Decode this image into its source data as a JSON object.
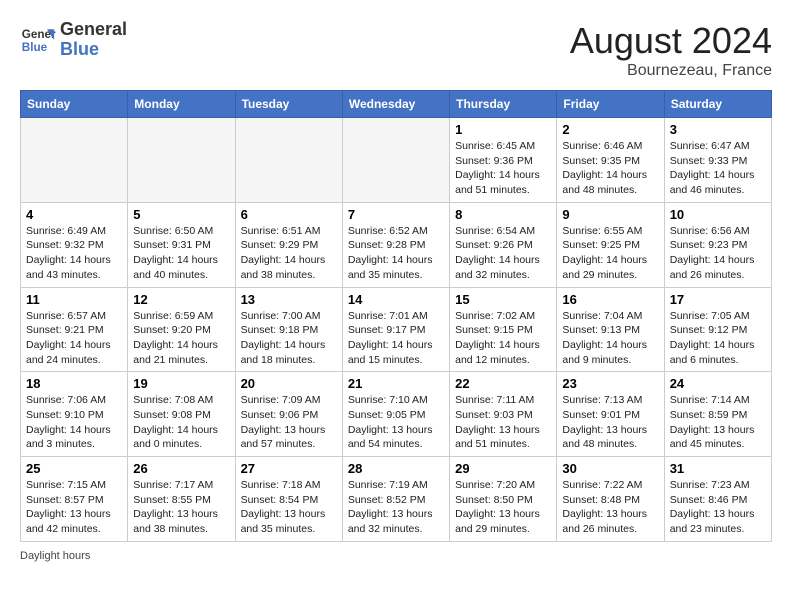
{
  "header": {
    "logo_line1": "General",
    "logo_line2": "Blue",
    "month_year": "August 2024",
    "location": "Bournezeau, France"
  },
  "days_of_week": [
    "Sunday",
    "Monday",
    "Tuesday",
    "Wednesday",
    "Thursday",
    "Friday",
    "Saturday"
  ],
  "weeks": [
    [
      {
        "day": "",
        "info": ""
      },
      {
        "day": "",
        "info": ""
      },
      {
        "day": "",
        "info": ""
      },
      {
        "day": "",
        "info": ""
      },
      {
        "day": "1",
        "info": "Sunrise: 6:45 AM\nSunset: 9:36 PM\nDaylight: 14 hours and 51 minutes."
      },
      {
        "day": "2",
        "info": "Sunrise: 6:46 AM\nSunset: 9:35 PM\nDaylight: 14 hours and 48 minutes."
      },
      {
        "day": "3",
        "info": "Sunrise: 6:47 AM\nSunset: 9:33 PM\nDaylight: 14 hours and 46 minutes."
      }
    ],
    [
      {
        "day": "4",
        "info": "Sunrise: 6:49 AM\nSunset: 9:32 PM\nDaylight: 14 hours and 43 minutes."
      },
      {
        "day": "5",
        "info": "Sunrise: 6:50 AM\nSunset: 9:31 PM\nDaylight: 14 hours and 40 minutes."
      },
      {
        "day": "6",
        "info": "Sunrise: 6:51 AM\nSunset: 9:29 PM\nDaylight: 14 hours and 38 minutes."
      },
      {
        "day": "7",
        "info": "Sunrise: 6:52 AM\nSunset: 9:28 PM\nDaylight: 14 hours and 35 minutes."
      },
      {
        "day": "8",
        "info": "Sunrise: 6:54 AM\nSunset: 9:26 PM\nDaylight: 14 hours and 32 minutes."
      },
      {
        "day": "9",
        "info": "Sunrise: 6:55 AM\nSunset: 9:25 PM\nDaylight: 14 hours and 29 minutes."
      },
      {
        "day": "10",
        "info": "Sunrise: 6:56 AM\nSunset: 9:23 PM\nDaylight: 14 hours and 26 minutes."
      }
    ],
    [
      {
        "day": "11",
        "info": "Sunrise: 6:57 AM\nSunset: 9:21 PM\nDaylight: 14 hours and 24 minutes."
      },
      {
        "day": "12",
        "info": "Sunrise: 6:59 AM\nSunset: 9:20 PM\nDaylight: 14 hours and 21 minutes."
      },
      {
        "day": "13",
        "info": "Sunrise: 7:00 AM\nSunset: 9:18 PM\nDaylight: 14 hours and 18 minutes."
      },
      {
        "day": "14",
        "info": "Sunrise: 7:01 AM\nSunset: 9:17 PM\nDaylight: 14 hours and 15 minutes."
      },
      {
        "day": "15",
        "info": "Sunrise: 7:02 AM\nSunset: 9:15 PM\nDaylight: 14 hours and 12 minutes."
      },
      {
        "day": "16",
        "info": "Sunrise: 7:04 AM\nSunset: 9:13 PM\nDaylight: 14 hours and 9 minutes."
      },
      {
        "day": "17",
        "info": "Sunrise: 7:05 AM\nSunset: 9:12 PM\nDaylight: 14 hours and 6 minutes."
      }
    ],
    [
      {
        "day": "18",
        "info": "Sunrise: 7:06 AM\nSunset: 9:10 PM\nDaylight: 14 hours and 3 minutes."
      },
      {
        "day": "19",
        "info": "Sunrise: 7:08 AM\nSunset: 9:08 PM\nDaylight: 14 hours and 0 minutes."
      },
      {
        "day": "20",
        "info": "Sunrise: 7:09 AM\nSunset: 9:06 PM\nDaylight: 13 hours and 57 minutes."
      },
      {
        "day": "21",
        "info": "Sunrise: 7:10 AM\nSunset: 9:05 PM\nDaylight: 13 hours and 54 minutes."
      },
      {
        "day": "22",
        "info": "Sunrise: 7:11 AM\nSunset: 9:03 PM\nDaylight: 13 hours and 51 minutes."
      },
      {
        "day": "23",
        "info": "Sunrise: 7:13 AM\nSunset: 9:01 PM\nDaylight: 13 hours and 48 minutes."
      },
      {
        "day": "24",
        "info": "Sunrise: 7:14 AM\nSunset: 8:59 PM\nDaylight: 13 hours and 45 minutes."
      }
    ],
    [
      {
        "day": "25",
        "info": "Sunrise: 7:15 AM\nSunset: 8:57 PM\nDaylight: 13 hours and 42 minutes."
      },
      {
        "day": "26",
        "info": "Sunrise: 7:17 AM\nSunset: 8:55 PM\nDaylight: 13 hours and 38 minutes."
      },
      {
        "day": "27",
        "info": "Sunrise: 7:18 AM\nSunset: 8:54 PM\nDaylight: 13 hours and 35 minutes."
      },
      {
        "day": "28",
        "info": "Sunrise: 7:19 AM\nSunset: 8:52 PM\nDaylight: 13 hours and 32 minutes."
      },
      {
        "day": "29",
        "info": "Sunrise: 7:20 AM\nSunset: 8:50 PM\nDaylight: 13 hours and 29 minutes."
      },
      {
        "day": "30",
        "info": "Sunrise: 7:22 AM\nSunset: 8:48 PM\nDaylight: 13 hours and 26 minutes."
      },
      {
        "day": "31",
        "info": "Sunrise: 7:23 AM\nSunset: 8:46 PM\nDaylight: 13 hours and 23 minutes."
      }
    ]
  ],
  "footer": {
    "note": "Daylight hours"
  }
}
